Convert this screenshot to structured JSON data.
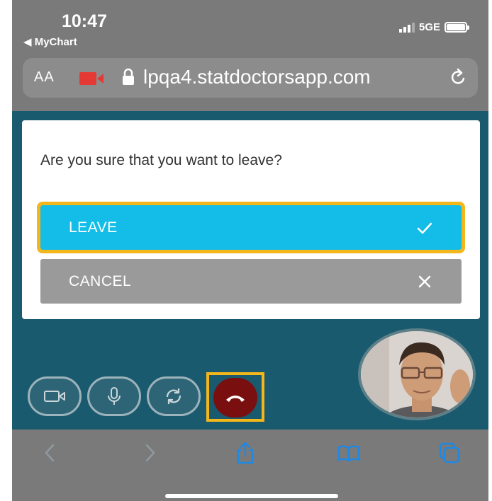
{
  "status_bar": {
    "time": "10:47",
    "back_app": "◀ MyChart",
    "network": "5GE"
  },
  "address_bar": {
    "text_size_label": "AA",
    "url": "lpqa4.statdoctorsapp.com",
    "recording_color": "#e53935"
  },
  "dialog": {
    "question": "Are you sure that you want to leave?",
    "leave_label": "LEAVE",
    "cancel_label": "CANCEL",
    "leave_color": "#13bde8",
    "cancel_color": "#9a9a9a",
    "highlight_color": "#f3b61b"
  },
  "call_controls": {
    "icons": [
      "video-camera-icon",
      "microphone-icon",
      "switch-camera-icon",
      "hang-up-icon"
    ],
    "hangup_color": "#7a0f0f"
  },
  "toolbar": {
    "icons": [
      "back-icon",
      "forward-icon",
      "share-icon",
      "bookmarks-icon",
      "tabs-icon"
    ]
  }
}
